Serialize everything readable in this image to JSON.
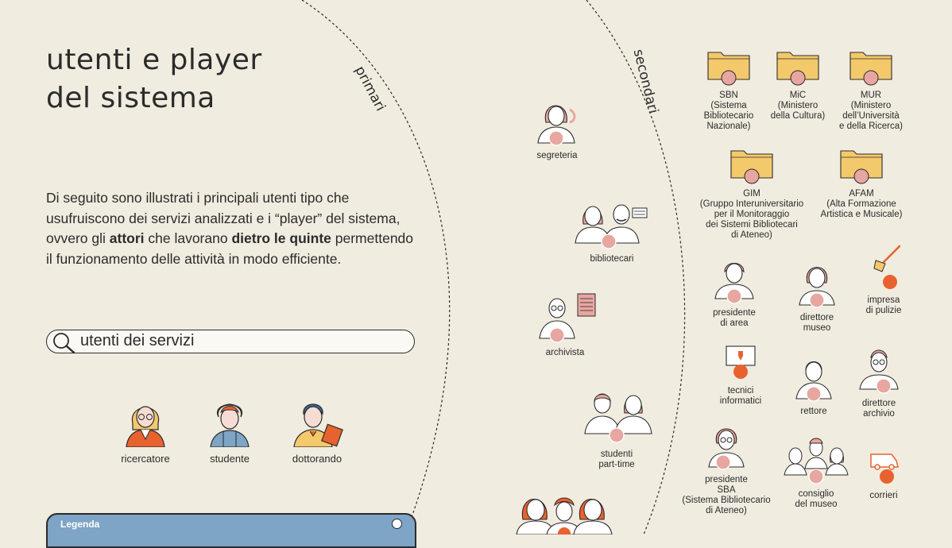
{
  "title": {
    "line1": "utenti e player",
    "line2": "del sistema"
  },
  "intro": {
    "part1": "Di seguito sono illustrati i principali utenti tipo che usufruiscono dei servizi analizzati e i “player” del sistema, ovvero gli ",
    "bold1": "attori",
    "part2": " che lavorano ",
    "bold2": "dietro le quinte",
    "part3": " permettendo il funzionamento delle attività in modo efficiente."
  },
  "search": {
    "label": "utenti dei servizi",
    "icon": "search-icon"
  },
  "users": [
    {
      "label": "ricercatore",
      "icon": "researcher-icon"
    },
    {
      "label": "studente",
      "icon": "student-icon"
    },
    {
      "label": "dottorando",
      "icon": "phd-student-icon"
    }
  ],
  "legend": {
    "label": "Legenda"
  },
  "rings": {
    "primary": "primari",
    "secondary": "secondari"
  },
  "primary_actors": [
    {
      "label": "segreteria",
      "icon": "secretary-icon"
    },
    {
      "label": "bibliotecari",
      "icon": "librarians-icon"
    },
    {
      "label": "archivista",
      "icon": "archivist-icon"
    },
    {
      "label": "studenti\npart-time",
      "icon": "part-time-students-icon"
    }
  ],
  "secondary_actors": [
    {
      "label": "SBN\n(Sistema\nBibliotecario\nNazionale)",
      "icon": "folder-icon"
    },
    {
      "label": "MiC\n(Ministero\ndella Cultura)",
      "icon": "folder-icon"
    },
    {
      "label": "MUR\n(Ministero\ndell’Università\ne della Ricerca)",
      "icon": "folder-icon"
    },
    {
      "label": "GIM\n(Gruppo Interuniversitario\nper il Monitoraggio\ndei Sistemi Bibliotecari\ndi Ateneo)",
      "icon": "folder-icon"
    },
    {
      "label": "AFAM\n(Alta Formazione\nArtistica e Musicale)",
      "icon": "folder-icon"
    },
    {
      "label": "presidente\ndi area",
      "icon": "president-icon"
    },
    {
      "label": "direttore\nmuseo",
      "icon": "museum-director-icon"
    },
    {
      "label": "impresa\ndi pulizie",
      "icon": "broom-icon"
    },
    {
      "label": "tecnici\ninformatici",
      "icon": "computer-icon"
    },
    {
      "label": "rettore",
      "icon": "rector-icon"
    },
    {
      "label": "direttore\narchivio",
      "icon": "archive-director-icon"
    },
    {
      "label": "presidente\nSBA\n(Sistema Bibliotecario\ndi Ateneo)",
      "icon": "sba-president-icon"
    },
    {
      "label": "consiglio\ndel museo",
      "icon": "museum-council-icon"
    },
    {
      "label": "corrieri",
      "icon": "van-icon"
    }
  ],
  "colors": {
    "background": "#f1ece0",
    "pink": "#e8a6a0",
    "orange": "#e8622f",
    "folder": "#f4c96b",
    "legend": "#7ea4c6"
  }
}
